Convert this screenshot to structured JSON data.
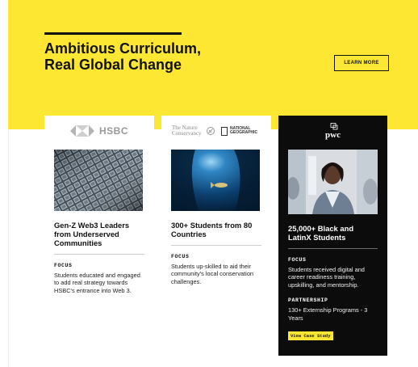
{
  "hero": {
    "title": "Ambitious Curriculum, Real Global Change",
    "cta_label": "LEARN MORE",
    "background_color": "#fde733"
  },
  "cards": [
    {
      "logo_text": "HSBC",
      "title": "Gen-Z Web3 Leaders from Underserved Communities",
      "focus_label": "FOCUS",
      "focus_text": "Students educated and engaged to add real strategy towards HSBC's entrance into Web 3."
    },
    {
      "logo_text_1": "The Nature Conservancy",
      "logo_text_2": "NATIONAL GEOGRAPHIC",
      "title": "300+ Students from 80 Countries",
      "focus_label": "FOCUS",
      "focus_text": "Students up-skilled to aid their community's local conservation challenges."
    },
    {
      "logo_text": "pwc",
      "title": "25,000+ Black and LatinX Students",
      "focus_label": "FOCUS",
      "focus_text": "Students received digital and career readiness training, upskilling, and mentorship.",
      "partnership_label": "PARTNERSHIP",
      "partnership_text": "130+ Externship Programs - 3 Years",
      "cta_label": "View Case Study"
    }
  ],
  "icons": {
    "hsbc": "hsbc-hexagon-logo",
    "tnc": "nature-conservancy-logo",
    "natgeo": "national-geographic-logo",
    "pwc": "pwc-logo"
  }
}
